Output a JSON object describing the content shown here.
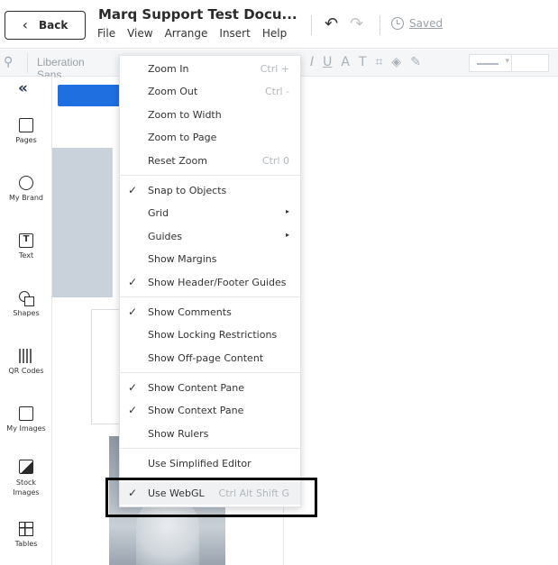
{
  "header": {
    "back_label": "Back",
    "doc_title": "Marq Support Test Docu...",
    "menus": [
      "File",
      "View",
      "Arrange",
      "Insert",
      "Help"
    ],
    "saved_label": "Saved"
  },
  "toolbar": {
    "font_name": "Liberation Sans"
  },
  "sidebar": {
    "items": [
      {
        "label": "Pages",
        "icon": "page-icon"
      },
      {
        "label": "My Brand",
        "icon": "brand-icon"
      },
      {
        "label": "Text",
        "icon": "text-icon"
      },
      {
        "label": "Shapes",
        "icon": "shapes-icon"
      },
      {
        "label": "QR Codes",
        "icon": "qr-code-icon"
      },
      {
        "label": "My Images",
        "icon": "folder-icon"
      },
      {
        "label": "Stock Images",
        "icon": "stock-image-icon"
      },
      {
        "label": "Tables",
        "icon": "table-icon"
      }
    ]
  },
  "view_menu": {
    "items": [
      {
        "label": "Zoom In",
        "shortcut": "Ctrl +",
        "checked": false
      },
      {
        "label": "Zoom Out",
        "shortcut": "Ctrl -",
        "checked": false
      },
      {
        "label": "Zoom to Width",
        "shortcut": "",
        "checked": false
      },
      {
        "label": "Zoom to Page",
        "shortcut": "",
        "checked": false
      },
      {
        "label": "Reset Zoom",
        "shortcut": "Ctrl 0",
        "checked": false
      },
      {
        "label": "Snap to Objects",
        "shortcut": "",
        "checked": true
      },
      {
        "label": "Grid",
        "shortcut": "",
        "checked": false,
        "submenu": true
      },
      {
        "label": "Guides",
        "shortcut": "",
        "checked": false,
        "submenu": true
      },
      {
        "label": "Show Margins",
        "shortcut": "",
        "checked": false
      },
      {
        "label": "Show Header/Footer Guides",
        "shortcut": "",
        "checked": true
      },
      {
        "label": "Show Comments",
        "shortcut": "",
        "checked": true
      },
      {
        "label": "Show Locking Restrictions",
        "shortcut": "",
        "checked": false
      },
      {
        "label": "Show Off-page Content",
        "shortcut": "",
        "checked": false
      },
      {
        "label": "Show Content Pane",
        "shortcut": "",
        "checked": true
      },
      {
        "label": "Show Context Pane",
        "shortcut": "",
        "checked": true
      },
      {
        "label": "Show Rulers",
        "shortcut": "",
        "checked": false
      },
      {
        "label": "Use Simplified Editor",
        "shortcut": "",
        "checked": false
      },
      {
        "label": "Use WebGL",
        "shortcut": "Ctrl Alt Shift G",
        "checked": true
      }
    ],
    "check_glyph": "✓",
    "submenu_glyph": "▸"
  },
  "colors": {
    "accent_blue": "#1f6fe0",
    "panel_gray": "#c9d1da",
    "highlight_border": "#000000"
  }
}
